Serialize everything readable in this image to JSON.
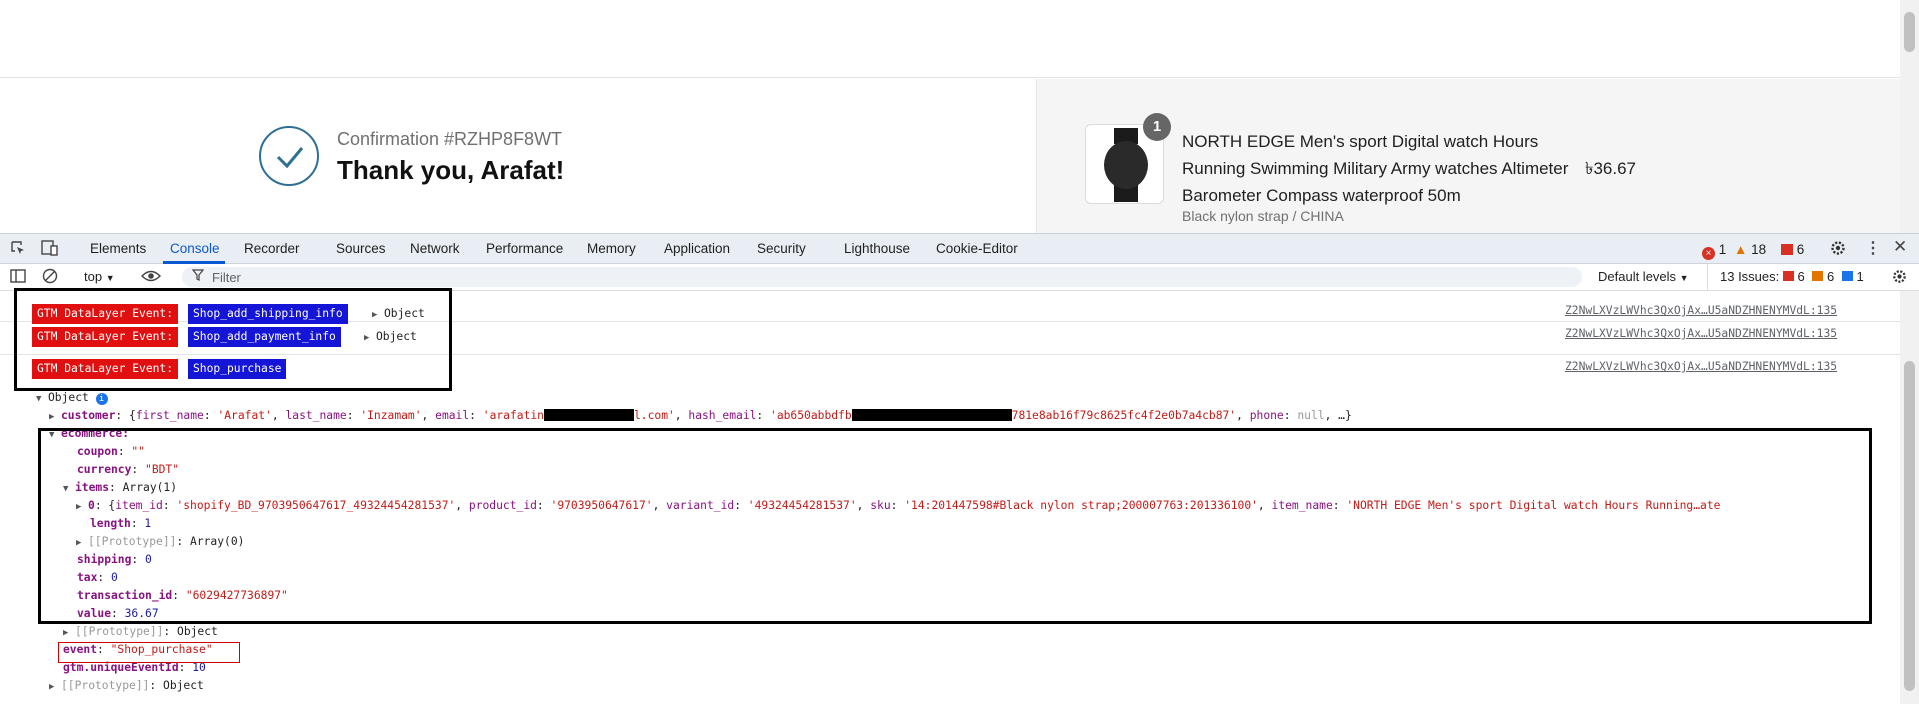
{
  "checkout": {
    "confirmation": "Confirmation #RZHP8F8WT",
    "thank_you": "Thank you, Arafat!",
    "product": {
      "qty": "1",
      "title": "NORTH EDGE Men's sport Digital watch Hours Running Swimming Military Army watches Altimeter Barometer Compass waterproof 50m",
      "variant": "Black nylon strap / CHINA",
      "price": "৳36.67"
    }
  },
  "devtools": {
    "tabs": [
      "Elements",
      "Console",
      "Recorder",
      "Sources",
      "Network",
      "Performance",
      "Memory",
      "Application",
      "Security",
      "Lighthouse",
      "Cookie-Editor"
    ],
    "active_tab": "Console",
    "counts": {
      "errors": "1",
      "warnings": "18",
      "issues": "6"
    },
    "toolbar": {
      "context": "top",
      "filter_placeholder": "Filter",
      "levels": "Default levels",
      "issues_label": "13 Issues:",
      "issue_red": "6",
      "issue_orange": "6",
      "issue_blue": "1"
    }
  },
  "console": {
    "logs": [
      {
        "prefix": "GTM DataLayer Event:",
        "event": "Shop_add_shipping_info",
        "obj": "Object",
        "src": "Z2NwLXVzLWVhc3QxOjAx…U5aNDZHNENYMVdL:135"
      },
      {
        "prefix": "GTM DataLayer Event:",
        "event": "Shop_add_payment_info",
        "obj": "Object",
        "src": "Z2NwLXVzLWVhc3QxOjAx…U5aNDZHNENYMVdL:135"
      },
      {
        "prefix": "GTM DataLayer Event:",
        "event": "Shop_purchase",
        "src": "Z2NwLXVzLWVhc3QxOjAx…U5aNDZHNENYMVdL:135"
      }
    ],
    "tree": {
      "root": "Object",
      "customer_key": "customer",
      "customer_preview": {
        "first_name": "'Arafat'",
        "last_name": "'Inzamam'",
        "email_start": "'arafatin",
        "email_end": "l.com'",
        "hash_start": "'ab650abbdfb",
        "hash_end": "781e8ab16f79c8625fc4f2e0b7a4cb87'",
        "phone": "null"
      },
      "ecommerce_key": "ecommerce:",
      "coupon": "\"\"",
      "currency": "\"BDT\"",
      "items_label": "Array(1)",
      "item0": {
        "item_id": "'shopify_BD_9703950647617_49324454281537'",
        "product_id": "'9703950647617'",
        "variant_id": "'49324454281537'",
        "sku": "'14:201447598#Black nylon strap;200007763:201336100'",
        "item_name": "'NORTH EDGE Men's sport Digital watch Hours Running…ate"
      },
      "length": "1",
      "proto_array": "Array(0)",
      "shipping": "0",
      "tax": "0",
      "transaction_id": "\"6029427736897\"",
      "value": "36.67",
      "proto_object": "Object",
      "event": "\"Shop_purchase\"",
      "unique_event_id": "10",
      "proto_root": "Object"
    }
  }
}
